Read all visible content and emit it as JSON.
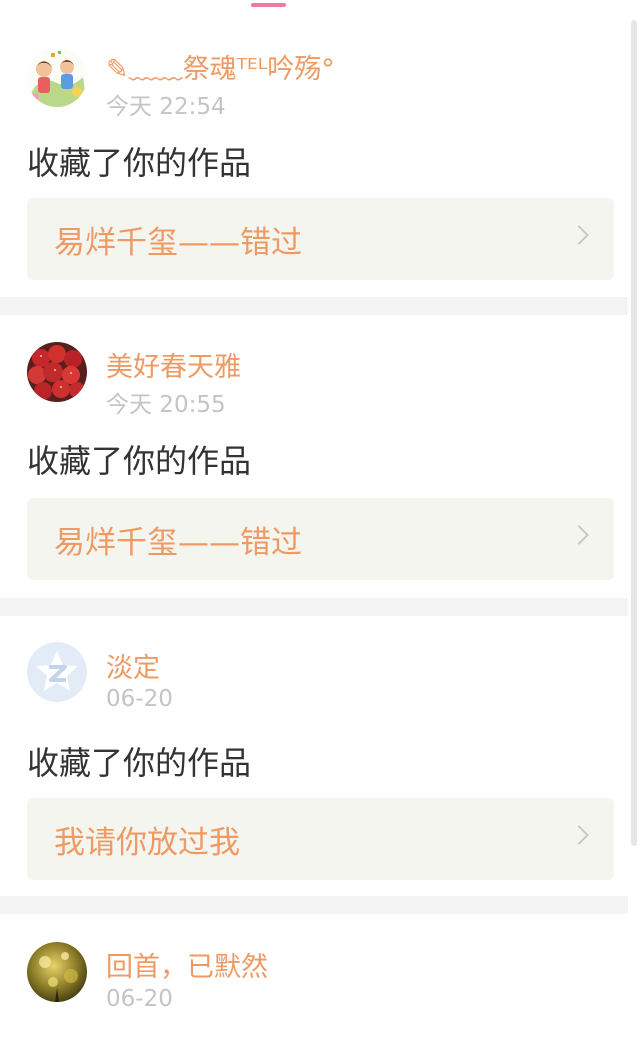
{
  "notifications": [
    {
      "user_name": "✎﹏﹏祭魂ᵀᴱᴸ吟殇°",
      "time": "今天 22:54",
      "action": "收藏了你的作品",
      "work_title": "易烊千玺——错过",
      "avatar_icon": "cartoon-kids-avatar-icon"
    },
    {
      "user_name": "美好春天雅",
      "time": "今天 20:55",
      "action": "收藏了你的作品",
      "work_title": "易烊千玺——错过",
      "avatar_icon": "strawberries-avatar-icon"
    },
    {
      "user_name": "淡定",
      "time": "06-20",
      "action": "收藏了你的作品",
      "work_title": "我请你放过我",
      "avatar_icon": "qzone-default-avatar-icon"
    },
    {
      "user_name": "回首，已默然",
      "time": "06-20",
      "avatar_icon": "golden-lights-avatar-icon"
    }
  ],
  "colors": {
    "accent": "#ee9a62",
    "indicator": "#e97aa3",
    "time_text": "#c4c4c4",
    "body_text": "#333333",
    "work_box_bg": "#f5f5f0",
    "separator": "#f4f4f4"
  }
}
